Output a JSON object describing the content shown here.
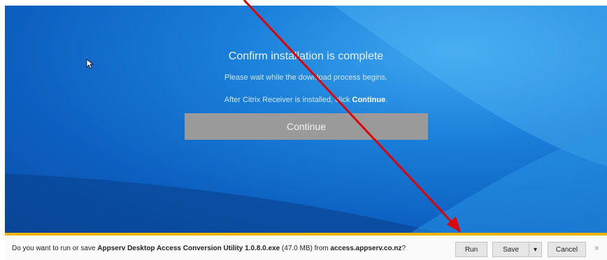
{
  "confirm": {
    "title": "Confirm installation is complete",
    "line1": "Please wait while the download process begins.",
    "line2_prefix": "After Citrix Receiver is installed, click ",
    "line2_bold": "Continue",
    "line2_suffix": ".",
    "continue_label": "Continue"
  },
  "download_bar": {
    "prefix": "Do you want to run or save ",
    "filename": "Appserv Desktop Access Conversion Utility 1.0.8.0.exe",
    "size": " (47.0 MB) from ",
    "source": "access.appserv.co.nz",
    "suffix": "?",
    "run_label": "Run",
    "save_label": "Save",
    "save_menu_glyph": "▾",
    "cancel_label": "Cancel",
    "close_glyph": "×"
  },
  "colors": {
    "accent_bar": "#f0b400",
    "annotation_arrow": "#e00000"
  }
}
